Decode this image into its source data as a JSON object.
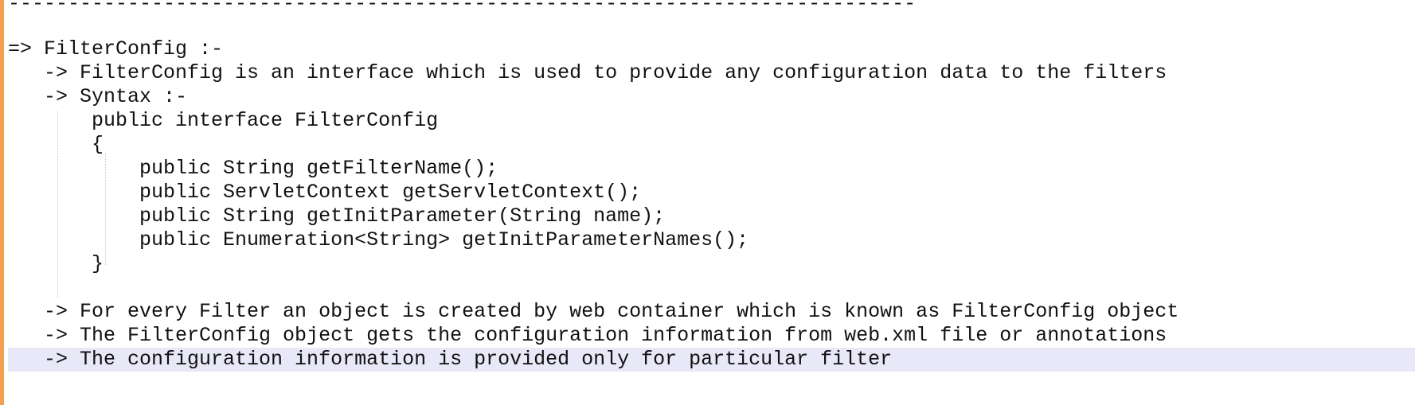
{
  "editor": {
    "separator": "----------------------------------------------------------------------------",
    "heading": "=> FilterConfig :-",
    "points_top": [
      "   -> FilterConfig is an interface which is used to provide any configuration data to the filters",
      "   -> Syntax :-"
    ],
    "code": [
      "       public interface FilterConfig",
      "       {",
      "           public String getFilterName();",
      "           public ServletContext getServletContext();",
      "           public String getInitParameter(String name);",
      "           public Enumeration<String> getInitParameterNames();",
      "       }"
    ],
    "points_bottom": [
      "   -> For every Filter an object is created by web container which is known as FilterConfig object",
      "   -> The FilterConfig object gets the configuration information from web.xml file or annotations",
      "   -> The configuration information is provided only for particular filter"
    ]
  },
  "colors": {
    "margin_bar": "#f0a050",
    "current_line_highlight": "#e8e8f8",
    "text": "#111111",
    "indent_guide": "#c8c8c8"
  }
}
